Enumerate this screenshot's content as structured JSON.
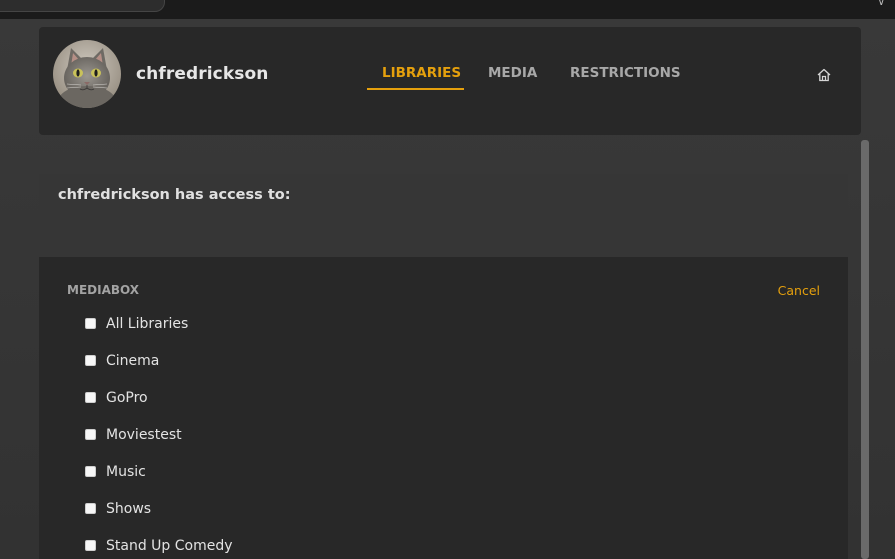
{
  "user": {
    "username": "chfredrickson"
  },
  "tabs": [
    {
      "label": "LIBRARIES",
      "active": true
    },
    {
      "label": "MEDIA",
      "active": false
    },
    {
      "label": "RESTRICTIONS",
      "active": false
    }
  ],
  "access": {
    "heading": "chfredrickson has access to:"
  },
  "server": {
    "name": "MEDIABOX",
    "cancel_label": "Cancel"
  },
  "libraries": [
    {
      "label": "All Libraries",
      "checked": false
    },
    {
      "label": "Cinema",
      "checked": false
    },
    {
      "label": "GoPro",
      "checked": false
    },
    {
      "label": "Moviestest",
      "checked": false
    },
    {
      "label": "Music",
      "checked": false
    },
    {
      "label": "Shows",
      "checked": false
    },
    {
      "label": "Stand Up Comedy",
      "checked": false
    }
  ],
  "colors": {
    "accent": "#e5a00d",
    "panel": "#282828",
    "background": "#3a3a3a"
  },
  "icons": {
    "home": "home-icon",
    "avatar": "cat-avatar-image",
    "topbar_menu": "chevron-down-icon"
  }
}
